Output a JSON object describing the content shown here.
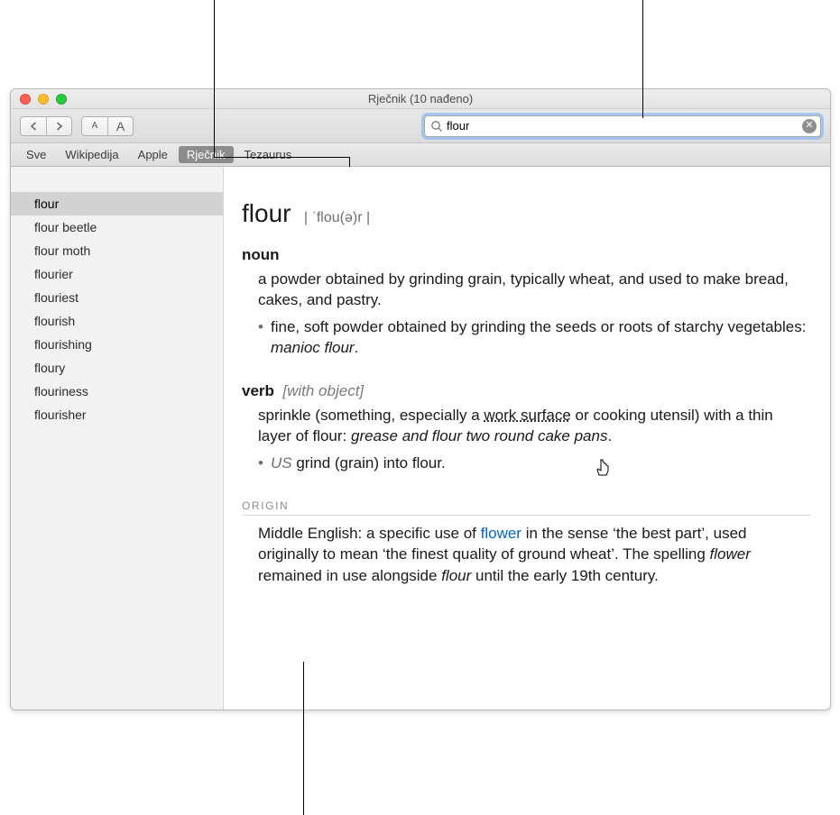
{
  "window": {
    "title": "Rječnik (10 nađeno)"
  },
  "search": {
    "value": "flour"
  },
  "tabs": [
    {
      "label": "Sve"
    },
    {
      "label": "Wikipedija"
    },
    {
      "label": "Apple"
    },
    {
      "label": "Rječnik",
      "active": true
    },
    {
      "label": "Tezaurus"
    }
  ],
  "sidebar": {
    "items": [
      "flour",
      "flour beetle",
      "flour moth",
      "flourier",
      "flouriest",
      "flourish",
      "flourishing",
      "floury",
      "flouriness",
      "flourisher"
    ],
    "selectedIndex": 0
  },
  "entry": {
    "headword": "flour",
    "pron": "| ˈflou(ə)r |",
    "noun": {
      "label": "noun",
      "def": "a powder obtained by grinding grain, typically wheat, and used to make bread, cakes, and pastry.",
      "sub_pre": "fine, soft powder obtained by grinding the seeds or roots of starchy vegetables: ",
      "sub_example": "manioc flour",
      "sub_post": "."
    },
    "verb": {
      "label": "verb",
      "gram": "[with object]",
      "def_pre": "sprinkle (something, especially a ",
      "def_link": "work surface",
      "def_mid": " or cooking utensil) with a thin layer of flour: ",
      "def_example": "grease and flour two round cake pans",
      "def_post": ".",
      "sub_region": "US",
      "sub_text": " grind (grain) into flour."
    },
    "origin": {
      "label": "ORIGIN",
      "t1": "Middle English: a specific use of ",
      "link": "flower",
      "t2": " in the sense ‘the best part’, used originally to mean ‘the finest quality of ground wheat’. The spelling ",
      "i1": "flower",
      "t3": " remained in use alongside ",
      "i2": "flour",
      "t4": " until the early 19th century."
    }
  }
}
